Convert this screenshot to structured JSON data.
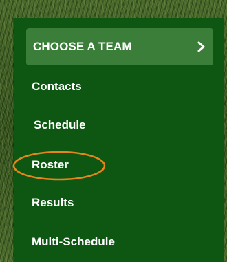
{
  "menu": {
    "choose_team_label": "CHOOSE A TEAM",
    "items": [
      {
        "label": "Contacts"
      },
      {
        "label": "Schedule"
      },
      {
        "label": "Roster"
      },
      {
        "label": "Results"
      },
      {
        "label": "Multi-Schedule"
      }
    ]
  },
  "annotation": {
    "highlighted_item": "Roster",
    "ellipse_color": "#e8851a"
  },
  "colors": {
    "panel_bg": "#0d5712",
    "button_bg": "#3b7e39",
    "text": "#ffffff"
  },
  "icons": {
    "choose_team_icon": "chevron-right-icon"
  }
}
